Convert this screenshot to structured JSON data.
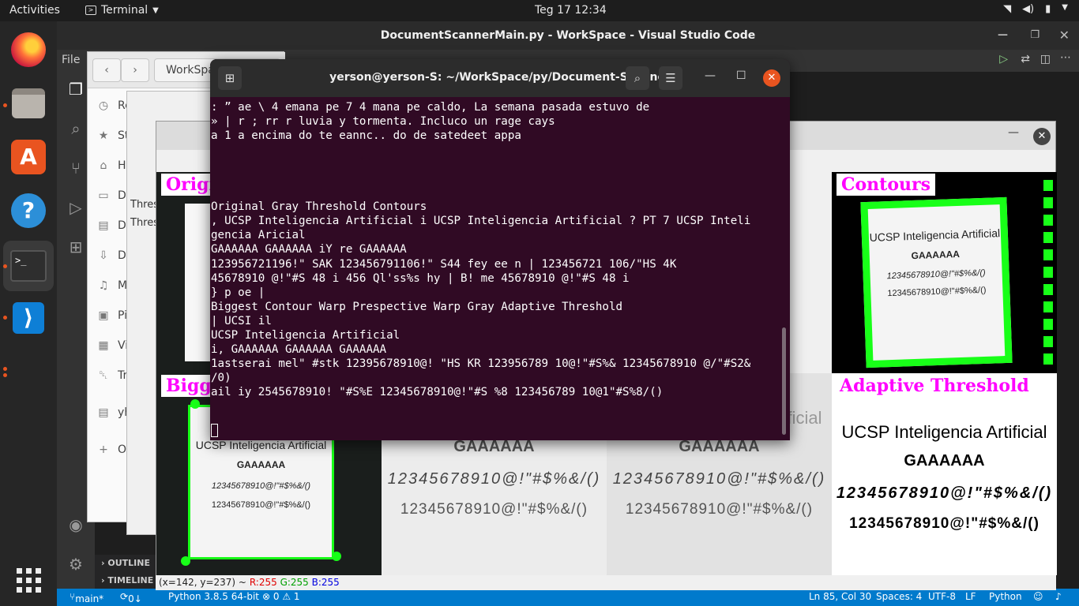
{
  "topbar": {
    "activities": "Activities",
    "app_menu": "Terminal",
    "clock": "Teg 17  12:34"
  },
  "vscode": {
    "title": "DocumentScannerMain.py - WorkSpace - Visual Studio Code",
    "menu_file": "File",
    "outline": "OUTLINE",
    "timeline": "TIMELINE",
    "status": {
      "branch": "main*",
      "sync": "0↓ 2↑",
      "python": "Python 3.8.5 64-bit",
      "problems": "⊗ 0 ⚠ 1",
      "position": "Ln 85, Col 30",
      "spaces": "Spaces: 4",
      "encoding": "UTF-8",
      "eol": "LF",
      "language": "Python"
    }
  },
  "files": {
    "path": "WorkSpa",
    "sidebar": [
      {
        "icon": "clock-icon",
        "glyph": "◷",
        "label": "Re"
      },
      {
        "icon": "star-icon",
        "glyph": "★",
        "label": "St"
      },
      {
        "icon": "home-icon",
        "glyph": "⌂",
        "label": "He"
      },
      {
        "icon": "desktop-icon",
        "glyph": "▭",
        "label": "De"
      },
      {
        "icon": "documents-icon",
        "glyph": "▤",
        "label": "Do"
      },
      {
        "icon": "downloads-icon",
        "glyph": "⇩",
        "label": "Downlo"
      },
      {
        "icon": "music-icon",
        "glyph": "♫",
        "label": "Music"
      },
      {
        "icon": "pictures-icon",
        "glyph": "▣",
        "label": "Pictures"
      },
      {
        "icon": "videos-icon",
        "glyph": "▦",
        "label": "Videos"
      },
      {
        "icon": "trash-icon",
        "glyph": "␡",
        "label": "Trash"
      },
      {
        "icon": "drive-icon",
        "glyph": "▤",
        "label": "yhon.sa"
      },
      {
        "icon": "plus-icon",
        "glyph": "+",
        "label": "Other L"
      }
    ]
  },
  "dialog": {
    "items": [
      "Thres",
      "Thres"
    ]
  },
  "image_window": {
    "coords": "(x=142, y=237) ~",
    "r": "R:255",
    "g": "G:255",
    "b": "B:255",
    "labels": {
      "original": "Origi",
      "contours": "Contours",
      "biggest": "Bigge",
      "adaptive": "Adaptive Threshold"
    },
    "doc_text": {
      "line1": "UCSP Inteligencia Artificial",
      "line2": "GAAAAAA",
      "line3": "12345678910@!\"#$%&/()",
      "line4": "12345678910@!\"#$%&/()"
    }
  },
  "terminal": {
    "title": "yerson@yerson-S: ~/WorkSpace/py/Document-Scanner",
    "output": ": ” ae \\ 4 emana pe 7 4 mana pe caldo, La semana pasada estuvo de\n» | r ; rr r luvia y tormenta. Incluco un rage cays\na 1 a encima do te eannc.. do de satedeet appa\n\n\n\n\nOriginal Gray Threshold Contours\n, UCSP Inteligencia Artificial i UCSP Inteligencia Artificial ? PT 7 UCSP Inteli\ngencia Aricial\nGAAAAAA GAAAAAA iY re GAAAAAA\n123956721196!\" SAK 123456791106!\" S44 fey ee n | 123456721 106/\"HS 4K\n45678910 @!\"#S 48 i 456 Ql'ss%s hy | B! me 45678910 @!\"#S 48 i\n} p oe |\nBiggest Contour Warp Prespective Warp Gray Adaptive Threshold\n| UCSI il\nUCSP Inteligencia Artificial\ni, GAAAAAA GAAAAAA GAAAAAA\n1astserai mel\" #stk 12395678910@! \"HS KR 123956789 10@!\"#S%& 12345678910 @/\"#S2&\n/0)\nail iy 2545678910! \"#S%E 12345678910@!\"#S %8 123456789 10@1\"#S%8/()"
  }
}
